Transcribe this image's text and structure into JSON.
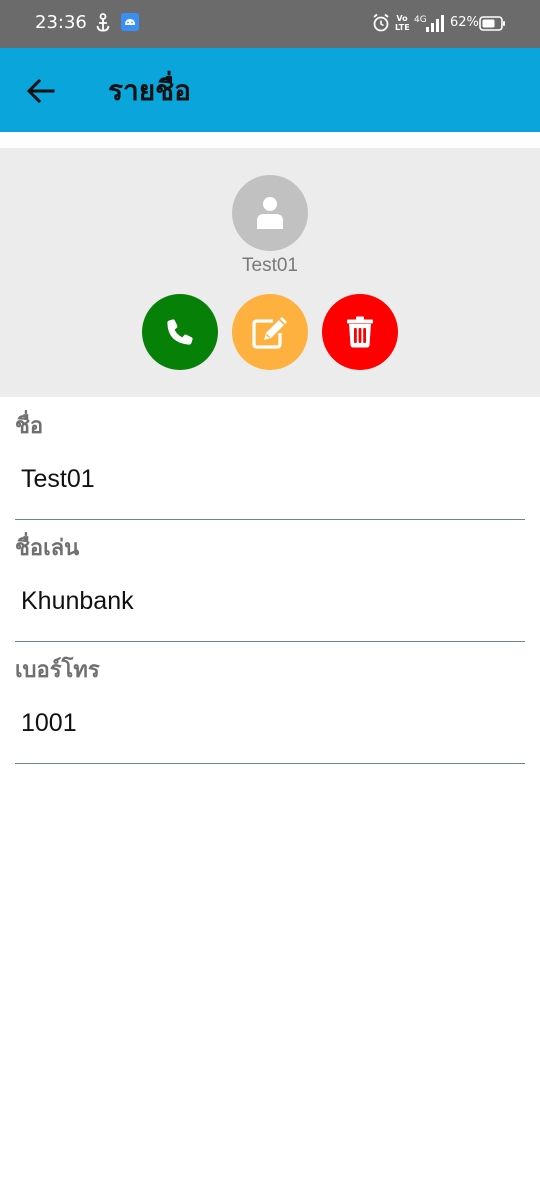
{
  "status_bar": {
    "time": "23:36",
    "network_top": "Vo",
    "network_bottom": "LTE",
    "signal_label": "4G",
    "battery_percent": "62%",
    "icons": [
      "anchor-icon",
      "android-app-icon",
      "alarm-icon",
      "signal-icon",
      "battery-icon"
    ]
  },
  "app_bar": {
    "title": "รายชื่อ",
    "back_icon": "arrow-left-icon",
    "background": "#0aa5db"
  },
  "contact": {
    "name": "Test01",
    "avatar_icon": "person-icon"
  },
  "actions": {
    "call": {
      "icon": "phone-icon",
      "color": "#078007"
    },
    "edit": {
      "icon": "edit-icon",
      "color": "#feb13f"
    },
    "delete": {
      "icon": "trash-icon",
      "color": "#fe0000"
    }
  },
  "fields": [
    {
      "label": "ชื่อ",
      "value": "Test01"
    },
    {
      "label": "ชื่อเล่น",
      "value": "Khunbank"
    },
    {
      "label": "เบอร์โทร",
      "value": "1001"
    }
  ]
}
